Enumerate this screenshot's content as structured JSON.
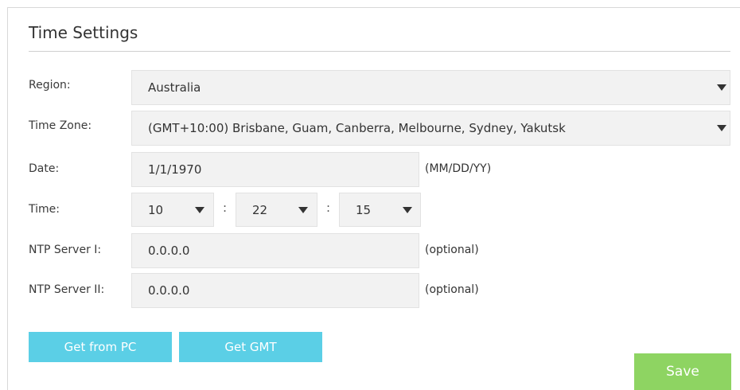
{
  "section": {
    "title": "Time Settings"
  },
  "region": {
    "label": "Region:",
    "value": "Australia"
  },
  "timezone": {
    "label": "Time Zone:",
    "value": "(GMT+10:00) Brisbane, Guam, Canberra, Melbourne, Sydney, Yakutsk"
  },
  "date": {
    "label": "Date:",
    "value": "1/1/1970",
    "hint": "(MM/DD/YY)"
  },
  "time": {
    "label": "Time:",
    "hours": "10",
    "minutes": "22",
    "seconds": "15",
    "separator": ":"
  },
  "ntp1": {
    "label": "NTP Server I:",
    "value": "0.0.0.0",
    "hint": "(optional)"
  },
  "ntp2": {
    "label": "NTP Server II:",
    "value": "0.0.0.0",
    "hint": "(optional)"
  },
  "buttons": {
    "get_from_pc": "Get from PC",
    "get_gmt": "Get GMT",
    "save": "Save"
  },
  "colors": {
    "button_blue": "#5bcfe6",
    "save_green": "#8ed462",
    "field_bg": "#f2f2f2"
  },
  "icons": {
    "dropdown": "chevron-down-icon"
  }
}
